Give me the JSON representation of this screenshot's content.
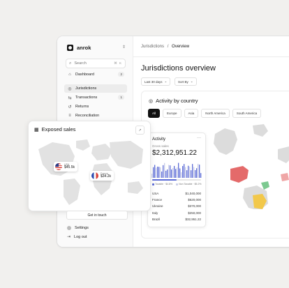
{
  "brand": {
    "name": "anrok"
  },
  "sidebar": {
    "search_placeholder": "Search",
    "search_kbd": "⌘ K",
    "items": [
      {
        "label": "Dashboard",
        "badge": "2"
      },
      {
        "label": "Jurisdictions",
        "badge": ""
      },
      {
        "label": "Transactions",
        "badge": "1"
      },
      {
        "label": "Returns",
        "badge": ""
      },
      {
        "label": "Reconciliation",
        "badge": ""
      }
    ],
    "settings_label": "Settings",
    "logout_label": "Log out",
    "get_in_touch": "Get in touch"
  },
  "breadcrumb": {
    "parent": "Jurisdictions",
    "separator": "/",
    "current": "Overview"
  },
  "page": {
    "title": "Jurisdictions overview",
    "filters": [
      "Last 30 days",
      "Sort By"
    ]
  },
  "activity_by_country": {
    "title": "Activity by country",
    "tabs": [
      "All",
      "Europe",
      "Asia",
      "North America",
      "South America"
    ],
    "active_tab": "All"
  },
  "activity_card": {
    "title": "Activity",
    "subtitle": "Gross sales",
    "amount": "$2,312,951.22",
    "taxable_fraction": 0.5,
    "legend": [
      "Taxable · $4.8%",
      "Non Taxable · $5.2%"
    ],
    "rows": [
      {
        "country": "USA",
        "value": "$1,040,000"
      },
      {
        "country": "France",
        "value": "$620,000"
      },
      {
        "country": "Ukraine",
        "value": "$370,000"
      },
      {
        "country": "Italy",
        "value": "$250,000"
      },
      {
        "country": "Brazil",
        "value": "$32,951.22"
      }
    ]
  },
  "exposed_sales": {
    "title": "Exposed sales",
    "pins": [
      {
        "name": "USA",
        "value": "$45.5k"
      },
      {
        "name": "France",
        "value": "$34.2k"
      }
    ]
  },
  "colors": {
    "accent": "#5b6bd6",
    "usa": "#e46a6a",
    "brazil": "#f2c84b",
    "green": "#7cc990"
  }
}
